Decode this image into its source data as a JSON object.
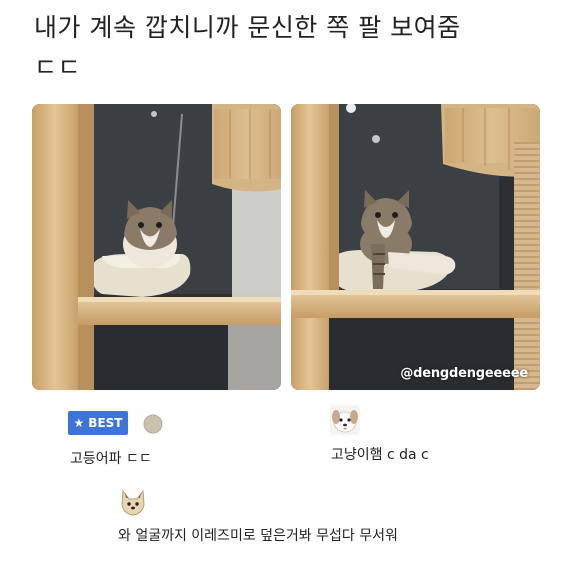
{
  "post": {
    "title_line1": "내가 계속 깝치니까 문신한 쪽 팔 보여줌",
    "title_line2": "ㄷㄷ"
  },
  "image": {
    "watermark": "@dengdengeeeee"
  },
  "comments": [
    {
      "badge": "BEST",
      "text": "고등어파 ㄷㄷ",
      "avatar": "grey-dot-avatar"
    },
    {
      "text": "고냥이햄 c da c",
      "avatar": "puppy-avatar"
    },
    {
      "text": "와 얼굴까지 이레즈미로 덮은거봐 무섭다 무서워",
      "avatar": "shiba-avatar"
    }
  ],
  "colors": {
    "badge_blue": "#3d74d8",
    "wood": "#d9b98a"
  }
}
